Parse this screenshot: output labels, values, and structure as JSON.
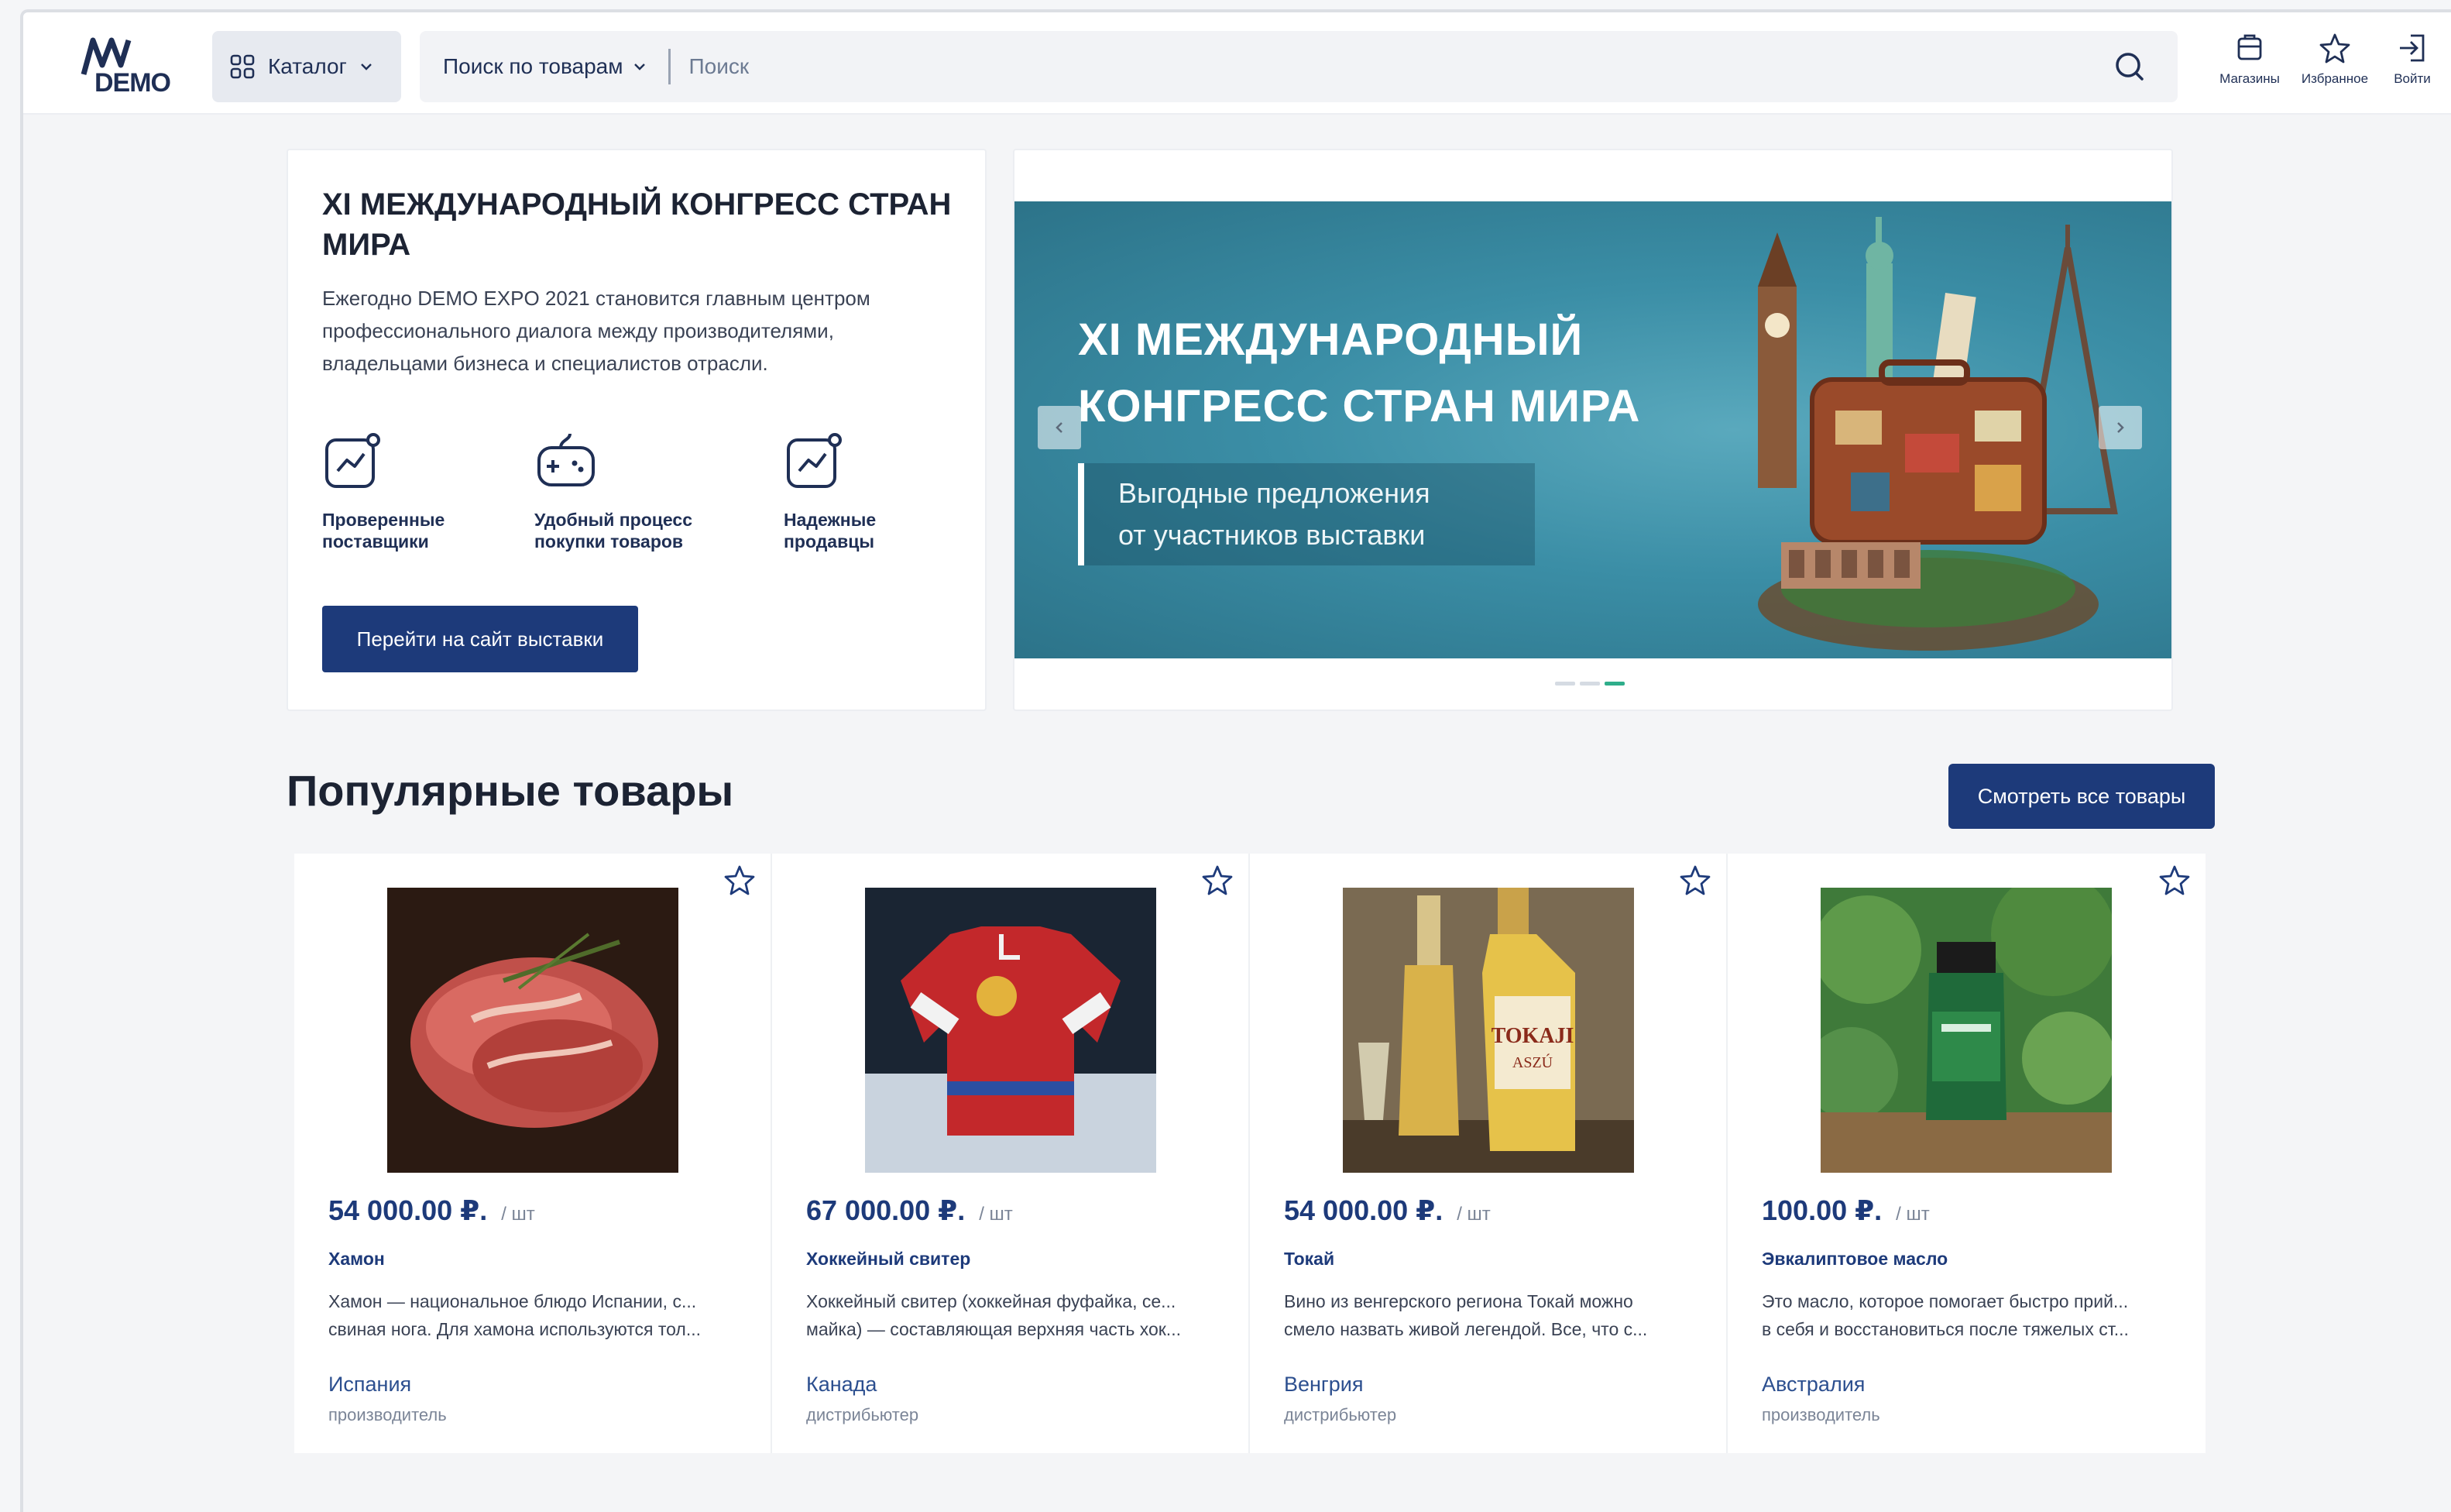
{
  "header": {
    "logo_text": "DEMO",
    "catalog_label": "Каталог",
    "search_scope_label": "Поиск по товарам",
    "search_placeholder": "Поиск",
    "actions": [
      {
        "label": "Магазины",
        "icon": "store-icon"
      },
      {
        "label": "Избранное",
        "icon": "star-icon"
      },
      {
        "label": "Войти",
        "icon": "login-icon"
      }
    ]
  },
  "promo": {
    "title": "XI МЕЖДУНАРОДНЫЙ КОНГРЕСС СТРАН МИРА",
    "text": "Ежегодно DEMO EXPO 2021 становится главным центром профессионального диалога между производителями, владельцами бизнеса и специалистов отрасли.",
    "features": [
      {
        "label_line1": "Проверенные",
        "label_line2": "поставщики",
        "icon": "chart-icon"
      },
      {
        "label_line1": "Удобный процесс",
        "label_line2": "покупки товаров",
        "icon": "gamepad-icon"
      },
      {
        "label_line1": "Надежные",
        "label_line2": "продавцы",
        "icon": "chart-icon"
      }
    ],
    "button_label": "Перейти на сайт выставки"
  },
  "banner": {
    "title_line1": "XI МЕЖДУНАРОДНЫЙ",
    "title_line2": "КОНГРЕСС СТРАН МИРА",
    "subtitle_line1": "Выгодные предложения",
    "subtitle_line2": "от участников выставки",
    "slides_count": 3,
    "active_slide": 3
  },
  "popular": {
    "title": "Популярные товары",
    "see_all_label": "Смотреть все товары",
    "products": [
      {
        "price": "54 000.00 ₽.",
        "unit": "/ шт",
        "name": "Хамон",
        "desc_line1": "Хамон — национальное блюдо Испании, с...",
        "desc_line2": "свиная нога. Для хамона используются тол...",
        "country": "Испания",
        "role": "производитель"
      },
      {
        "price": "67 000.00 ₽.",
        "unit": "/ шт",
        "name": "Хоккейный свитер",
        "desc_line1": "Хоккейный свитер (хоккейная фуфайка, се...",
        "desc_line2": "майка) — составляющая верхняя часть хок...",
        "country": "Канада",
        "role": "дистрибьютер"
      },
      {
        "price": "54 000.00 ₽.",
        "unit": "/ шт",
        "name": "Токай",
        "desc_line1": "Вино из венгерского региона Токай можно",
        "desc_line2": "смело назвать живой легендой. Все, что с...",
        "country": "Венгрия",
        "role": "дистрибьютер"
      },
      {
        "price": "100.00 ₽.",
        "unit": "/ шт",
        "name": "Эвкалиптовое масло",
        "desc_line1": "Это масло, которое помогает быстро прий...",
        "desc_line2": "в себя и восстановиться после тяжелых ст...",
        "country": "Австралия",
        "role": "производитель"
      }
    ]
  },
  "colors": {
    "brand_navy": "#1d3a7a",
    "banner_teal": "#3b8ea6",
    "slider_active": "#2fae8b"
  }
}
